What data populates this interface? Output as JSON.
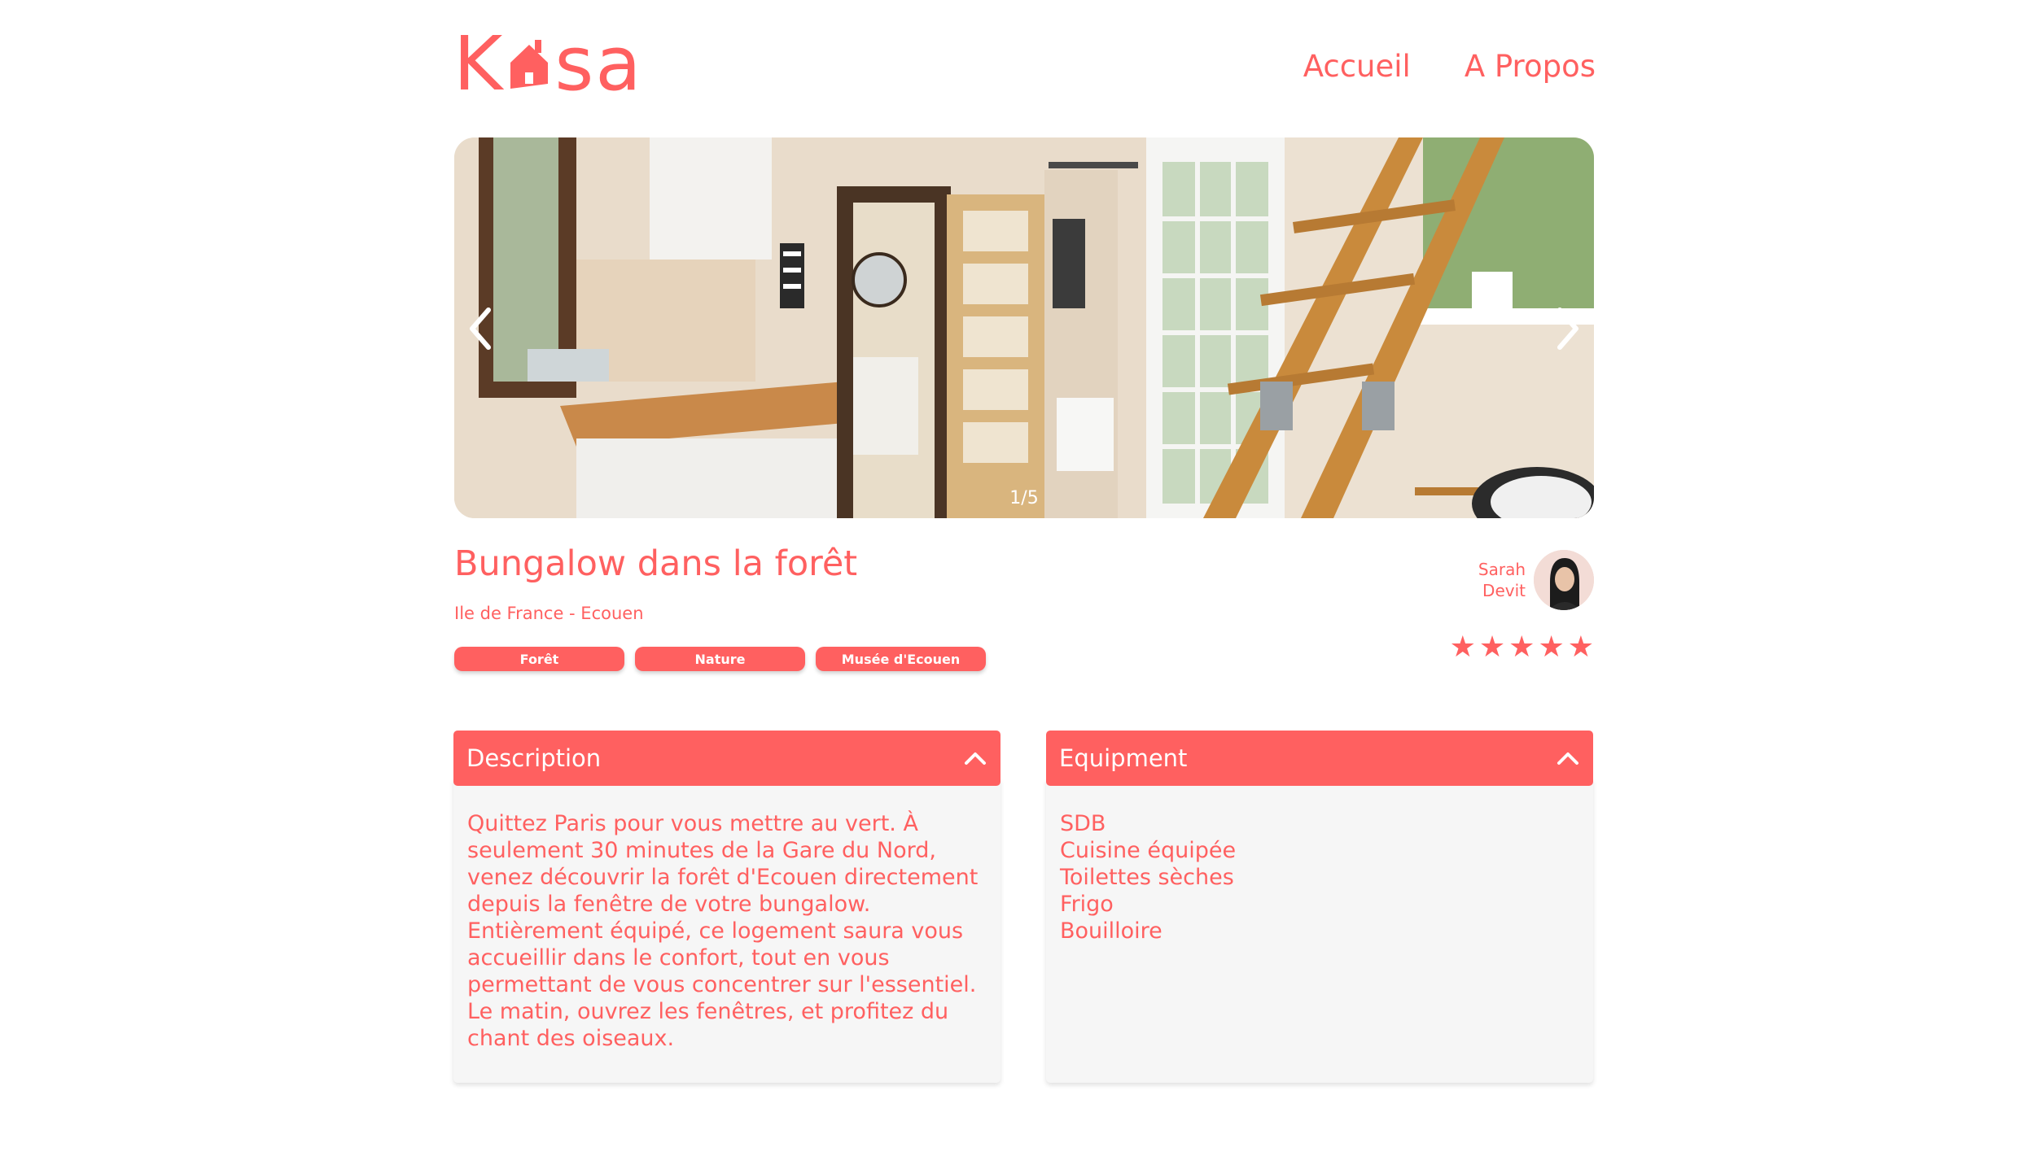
{
  "header": {
    "logo_text": "Kasa",
    "nav": [
      {
        "label": "Accueil"
      },
      {
        "label": "A Propos"
      }
    ]
  },
  "slideshow": {
    "counter": "1/5",
    "current": 1,
    "total": 5
  },
  "listing": {
    "title": "Bungalow dans la forêt",
    "location": "Ile de France - Ecouen",
    "tags": [
      "Forêt",
      "Nature",
      "Musée d'Ecouen"
    ],
    "host": {
      "first_name": "Sarah",
      "last_name": "Devit"
    },
    "rating": 5,
    "rating_max": 5
  },
  "description": {
    "title": "Description",
    "text": "Quittez Paris pour vous mettre au vert. À seulement 30 minutes de la Gare du Nord, venez découvrir la forêt d'Ecouen directement depuis la fenêtre de votre bungalow. Entièrement équipé, ce logement saura vous accueillir dans le confort, tout en vous permettant de vous concentrer sur l'essentiel. Le matin, ouvrez les fenêtres, et profitez du chant des oiseaux."
  },
  "equipment": {
    "title": "Equipment",
    "items": [
      "SDB",
      "Cuisine équipée",
      "Toilettes sèches",
      "Frigo",
      "Bouilloire"
    ]
  },
  "colors": {
    "accent": "#FF6060",
    "panel": "#F6F6F6",
    "white": "#FFFFFF"
  }
}
